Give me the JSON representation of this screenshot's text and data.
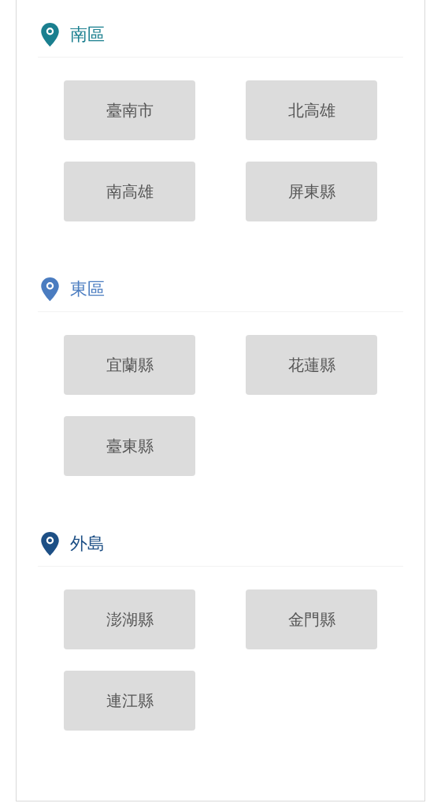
{
  "regions": [
    {
      "name": "南區",
      "color": "#1a7f8f",
      "cities": [
        "臺南市",
        "北高雄",
        "南高雄",
        "屏東縣"
      ]
    },
    {
      "name": "東區",
      "color": "#4a7cc0",
      "cities": [
        "宜蘭縣",
        "花蓮縣",
        "臺東縣"
      ]
    },
    {
      "name": "外島",
      "color": "#1d4f85",
      "cities": [
        "澎湖縣",
        "金門縣",
        "連江縣"
      ]
    }
  ]
}
